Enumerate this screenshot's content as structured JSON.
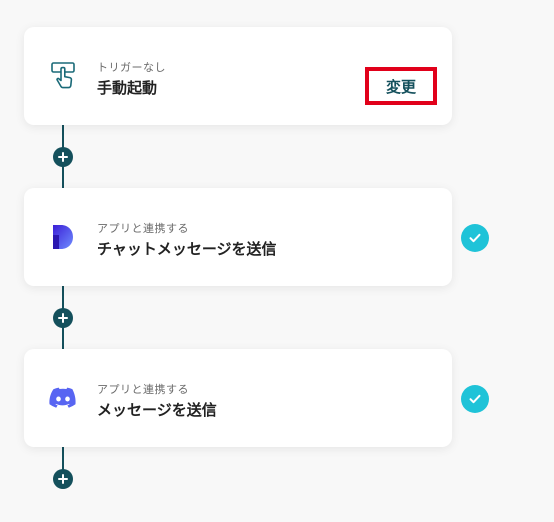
{
  "steps": [
    {
      "subtitle": "トリガーなし",
      "title": "手動起動",
      "icon": "manual-trigger-icon",
      "action_label": "変更"
    },
    {
      "subtitle": "アプリと連携する",
      "title": "チャットメッセージを送信",
      "icon": "dialpad-logo-icon",
      "status": "completed"
    },
    {
      "subtitle": "アプリと連携する",
      "title": "メッセージを送信",
      "icon": "discord-logo-icon",
      "status": "completed"
    }
  ],
  "colors": {
    "connector": "#14505c",
    "accent_check": "#1fc3d8",
    "highlight_border": "#e1001a",
    "discord": "#5865f2"
  }
}
